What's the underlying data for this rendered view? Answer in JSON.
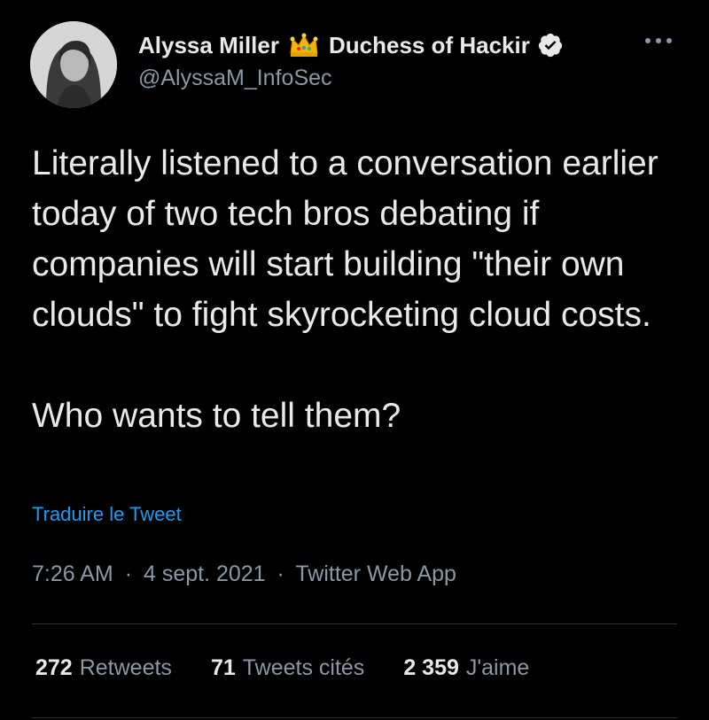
{
  "author": {
    "display_name": "Alyssa Miller",
    "display_name_suffix": "Duchess of Hackir",
    "handle": "@AlyssaM_InfoSec",
    "crown_icon": "crown-emoji",
    "verified_icon": "verified-badge-icon"
  },
  "tweet": {
    "paragraph_1": "Literally listened to a conversation earlier today of two tech bros debating if companies will start building \"their own clouds\" to fight skyrocketing cloud costs.",
    "paragraph_2": "Who wants to tell them?"
  },
  "translate_link": "Traduire le Tweet",
  "meta": {
    "time": "7:26 AM",
    "separator": "·",
    "date": "4 sept. 2021",
    "source": "Twitter Web App"
  },
  "stats": {
    "retweets": {
      "count": "272",
      "label": "Retweets"
    },
    "quotes": {
      "count": "71",
      "label": "Tweets cités"
    },
    "likes": {
      "count": "2 359",
      "label": "J'aime"
    }
  },
  "colors": {
    "background": "#000000",
    "text": "#e7e9ea",
    "secondary": "#8b98a5",
    "link": "#1d9bf0",
    "divider": "#2f3336"
  }
}
